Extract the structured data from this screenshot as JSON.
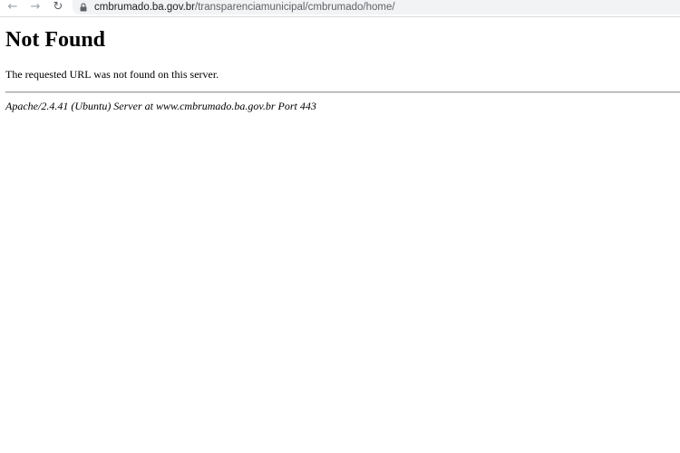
{
  "browser": {
    "back_icon": "arrow-left-icon",
    "forward_icon": "arrow-right-icon",
    "reload_icon": "reload-icon",
    "lock_icon": "lock-icon",
    "url_host": "cmbrumado.ba.gov.br",
    "url_path": "/transparenciamunicipal/cmbrumado/home/"
  },
  "page": {
    "title": "Not Found",
    "message": "The requested URL was not found on this server.",
    "server_signature": "Apache/2.4.41 (Ubuntu) Server at www.cmbrumado.ba.gov.br Port 443"
  }
}
